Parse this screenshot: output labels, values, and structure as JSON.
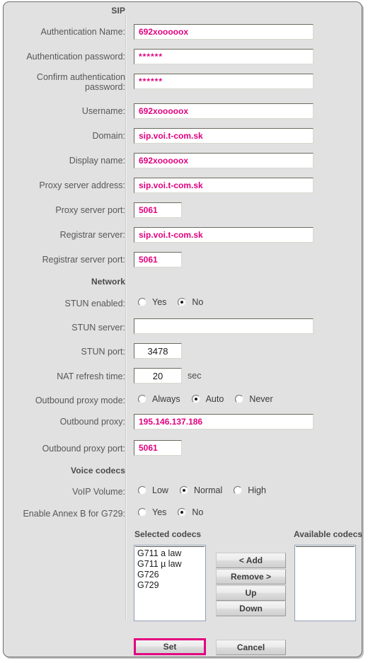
{
  "colors": {
    "accent_magenta": "#e2007f",
    "panel_bg": "#e1e1e1",
    "label_text": "#575757",
    "listbox_border": "#8ea0b5"
  },
  "sections": {
    "sip": "SIP",
    "network": "Network",
    "voice_codecs": "Voice codecs"
  },
  "sip": {
    "fields": [
      {
        "label": "Authentication Name:",
        "value": "692xooooox"
      },
      {
        "label": "Authentication password:",
        "value": "******"
      },
      {
        "label": "Confirm authentication password:",
        "value": "******"
      },
      {
        "label": "Username:",
        "value": "692xooooox"
      },
      {
        "label": "Domain:",
        "value": "sip.voi.t-com.sk"
      },
      {
        "label": "Display name:",
        "value": "692xooooox"
      },
      {
        "label": "Proxy server address:",
        "value": "sip.voi.t-com.sk"
      },
      {
        "label": "Proxy server port:",
        "value": "5061"
      },
      {
        "label": "Registrar server:",
        "value": "sip.voi.t-com.sk"
      },
      {
        "label": "Registrar server port:",
        "value": "5061"
      }
    ]
  },
  "network": {
    "stun_enabled_label": "STUN enabled:",
    "stun_enabled_options": [
      "Yes",
      "No"
    ],
    "stun_enabled_selected": "No",
    "stun_server_label": "STUN server:",
    "stun_server_value": "",
    "stun_port_label": "STUN port:",
    "stun_port_value": "3478",
    "nat_refresh_label": "NAT refresh time:",
    "nat_refresh_value": "20",
    "nat_refresh_unit": "sec",
    "outbound_mode_label": "Outbound proxy mode:",
    "outbound_mode_options": [
      "Always",
      "Auto",
      "Never"
    ],
    "outbound_mode_selected": "Auto",
    "outbound_proxy_label": "Outbound proxy:",
    "outbound_proxy_value": "195.146.137.186",
    "outbound_proxy_port_label": "Outbound proxy port:",
    "outbound_proxy_port_value": "5061"
  },
  "codecs": {
    "volume_label": "VoIP Volume:",
    "volume_options": [
      "Low",
      "Normal",
      "High"
    ],
    "volume_selected": "Normal",
    "annexb_label": "Enable Annex B for G729:",
    "annexb_options": [
      "Yes",
      "No"
    ],
    "annexb_selected": "No",
    "selected_header": "Selected codecs",
    "available_header": "Available codecs",
    "selected_list": [
      "G711 a law",
      "G711 µ law",
      "G726",
      "G729"
    ],
    "available_list": [],
    "buttons": {
      "add": "< Add",
      "remove": "Remove >",
      "up": "Up",
      "down": "Down"
    }
  },
  "footer": {
    "set": "Set",
    "cancel": "Cancel"
  }
}
